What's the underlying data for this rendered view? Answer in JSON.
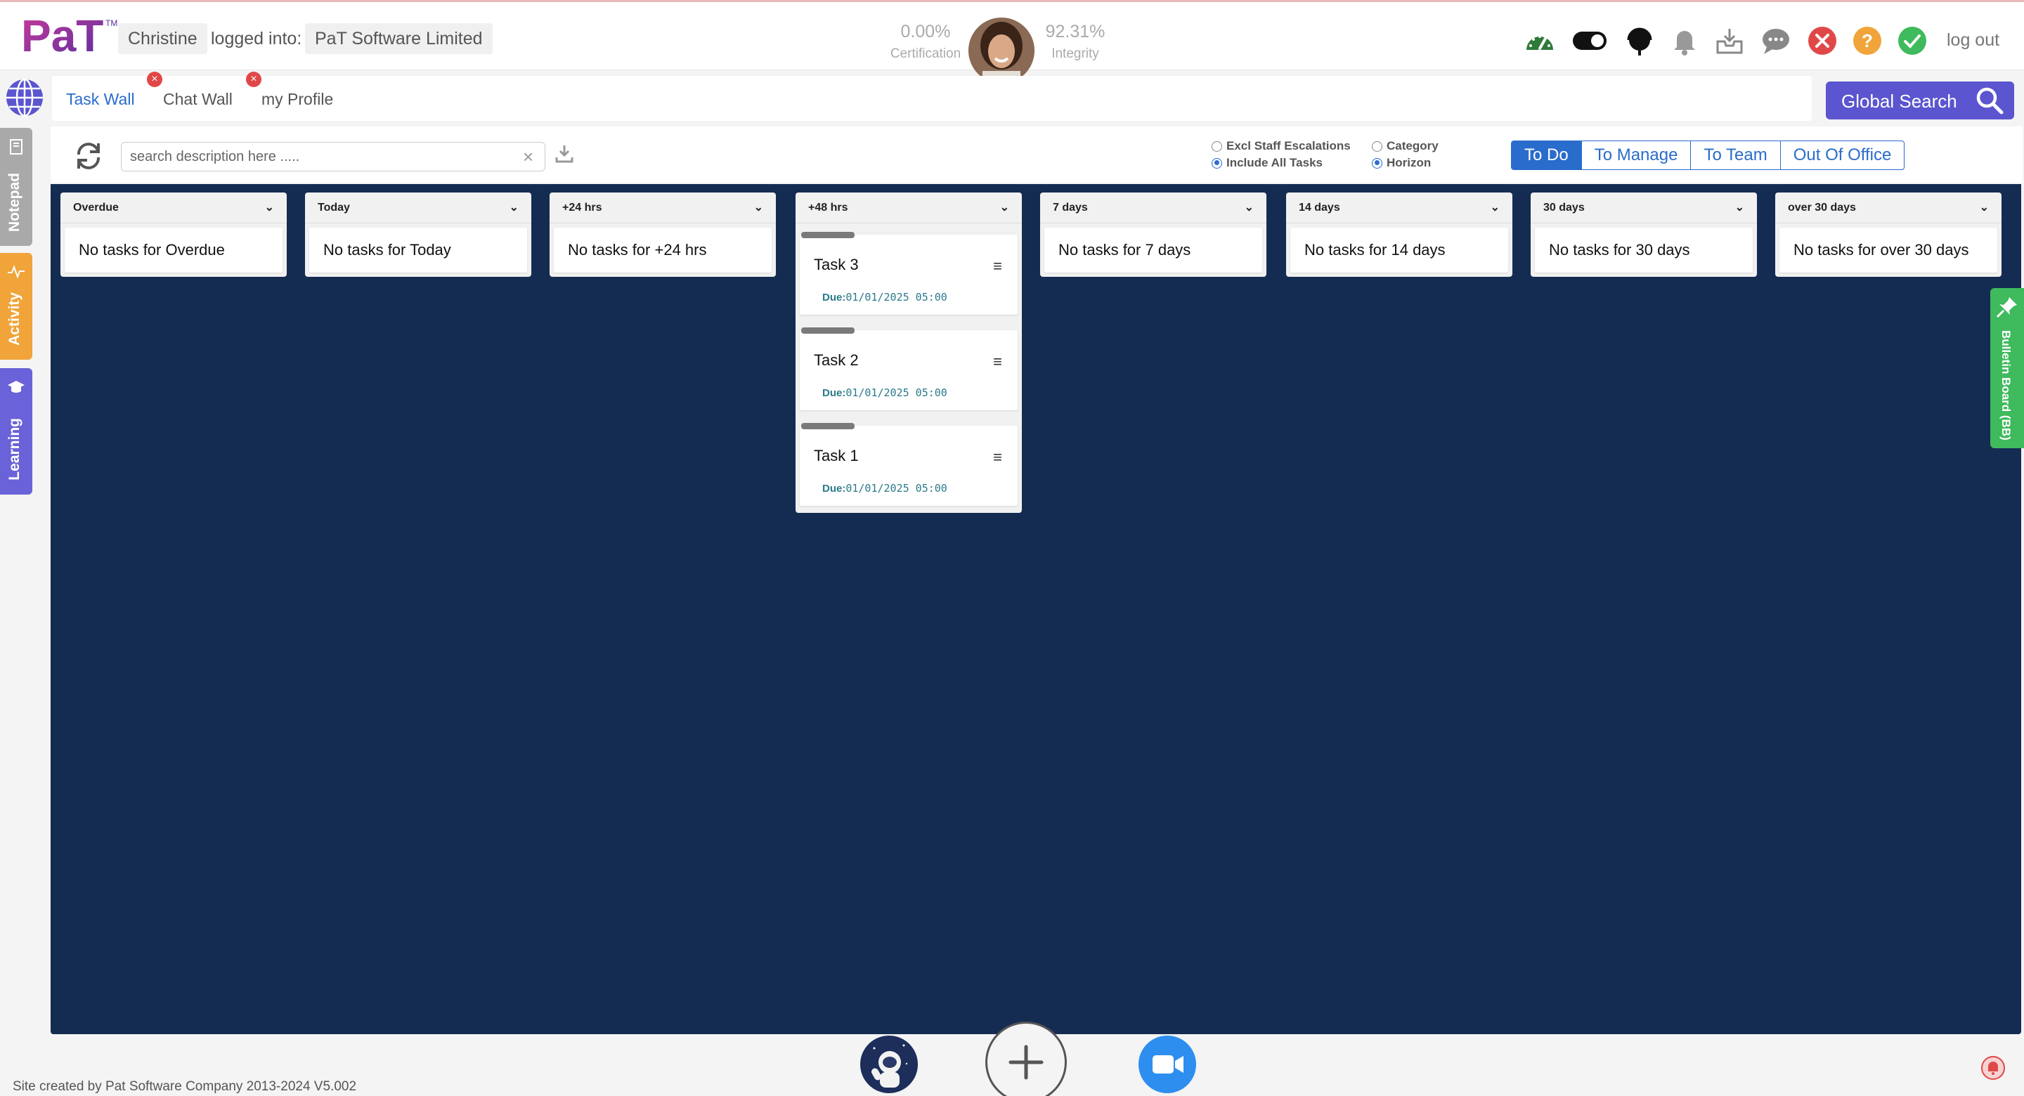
{
  "header": {
    "logo_text": "PaT",
    "logo_tm": "TM",
    "user": "Christine",
    "logged_into_label": "logged into:",
    "company": "PaT Software Limited",
    "certification_value": "0.00%",
    "certification_label": "Certification",
    "integrity_value": "92.31%",
    "integrity_label": "Integrity",
    "logout_label": "log out",
    "icons": [
      "speedometer-icon",
      "toggle-icon",
      "headset-icon",
      "bell-icon",
      "inbox-icon",
      "chat-bubble-icon",
      "close-circle-icon",
      "help-icon",
      "check-circle-icon"
    ]
  },
  "tabs": [
    {
      "label": "Task Wall",
      "active": true
    },
    {
      "label": "Chat Wall",
      "active": false
    },
    {
      "label": "my Profile",
      "active": false
    }
  ],
  "global_search": {
    "label": "Global Search"
  },
  "side_tabs": [
    {
      "label": "Notepad",
      "color": "#a9a9a9"
    },
    {
      "label": "Activity",
      "color": "#f0a43a"
    },
    {
      "label": "Learning",
      "color": "#6a62d8"
    }
  ],
  "toolbar": {
    "search_placeholder": "search description here .....",
    "options": [
      {
        "label": "Excl Staff Escalations",
        "checked": false
      },
      {
        "label": "Include All Tasks",
        "checked": true
      },
      {
        "label": "Category",
        "checked": false
      },
      {
        "label": "Horizon",
        "checked": true
      }
    ],
    "views": [
      {
        "label": "To Do",
        "active": true
      },
      {
        "label": "To Manage",
        "active": false
      },
      {
        "label": "To Team",
        "active": false
      },
      {
        "label": "Out Of Office",
        "active": false
      }
    ]
  },
  "columns": [
    {
      "title": "Overdue",
      "empty": "No tasks for Overdue",
      "tasks": []
    },
    {
      "title": "Today",
      "empty": "No tasks for Today",
      "tasks": []
    },
    {
      "title": "+24 hrs",
      "empty": "No tasks for +24 hrs",
      "tasks": []
    },
    {
      "title": "+48 hrs",
      "empty": "",
      "tasks": [
        {
          "name": "Task 3",
          "due_label": "Due:",
          "due": "01/01/2025 05:00"
        },
        {
          "name": "Task 2",
          "due_label": "Due:",
          "due": "01/01/2025 05:00"
        },
        {
          "name": "Task 1",
          "due_label": "Due:",
          "due": "01/01/2025 05:00"
        }
      ]
    },
    {
      "title": "7 days",
      "empty": "No tasks for 7 days",
      "tasks": []
    },
    {
      "title": "14 days",
      "empty": "No tasks for 14 days",
      "tasks": []
    },
    {
      "title": "30 days",
      "empty": "No tasks for 30 days",
      "tasks": []
    },
    {
      "title": "over 30 days",
      "empty": "No tasks for over 30 days",
      "tasks": []
    }
  ],
  "bulletin": {
    "label": "Bulletin Board (BB)"
  },
  "footer": {
    "text": "Site created by Pat Software Company 2013-2024 V5.002"
  },
  "colors": {
    "board": "#152c52",
    "accent": "#2a6ccc",
    "search": "#5b55cf",
    "bulletin": "#3fba5d"
  }
}
